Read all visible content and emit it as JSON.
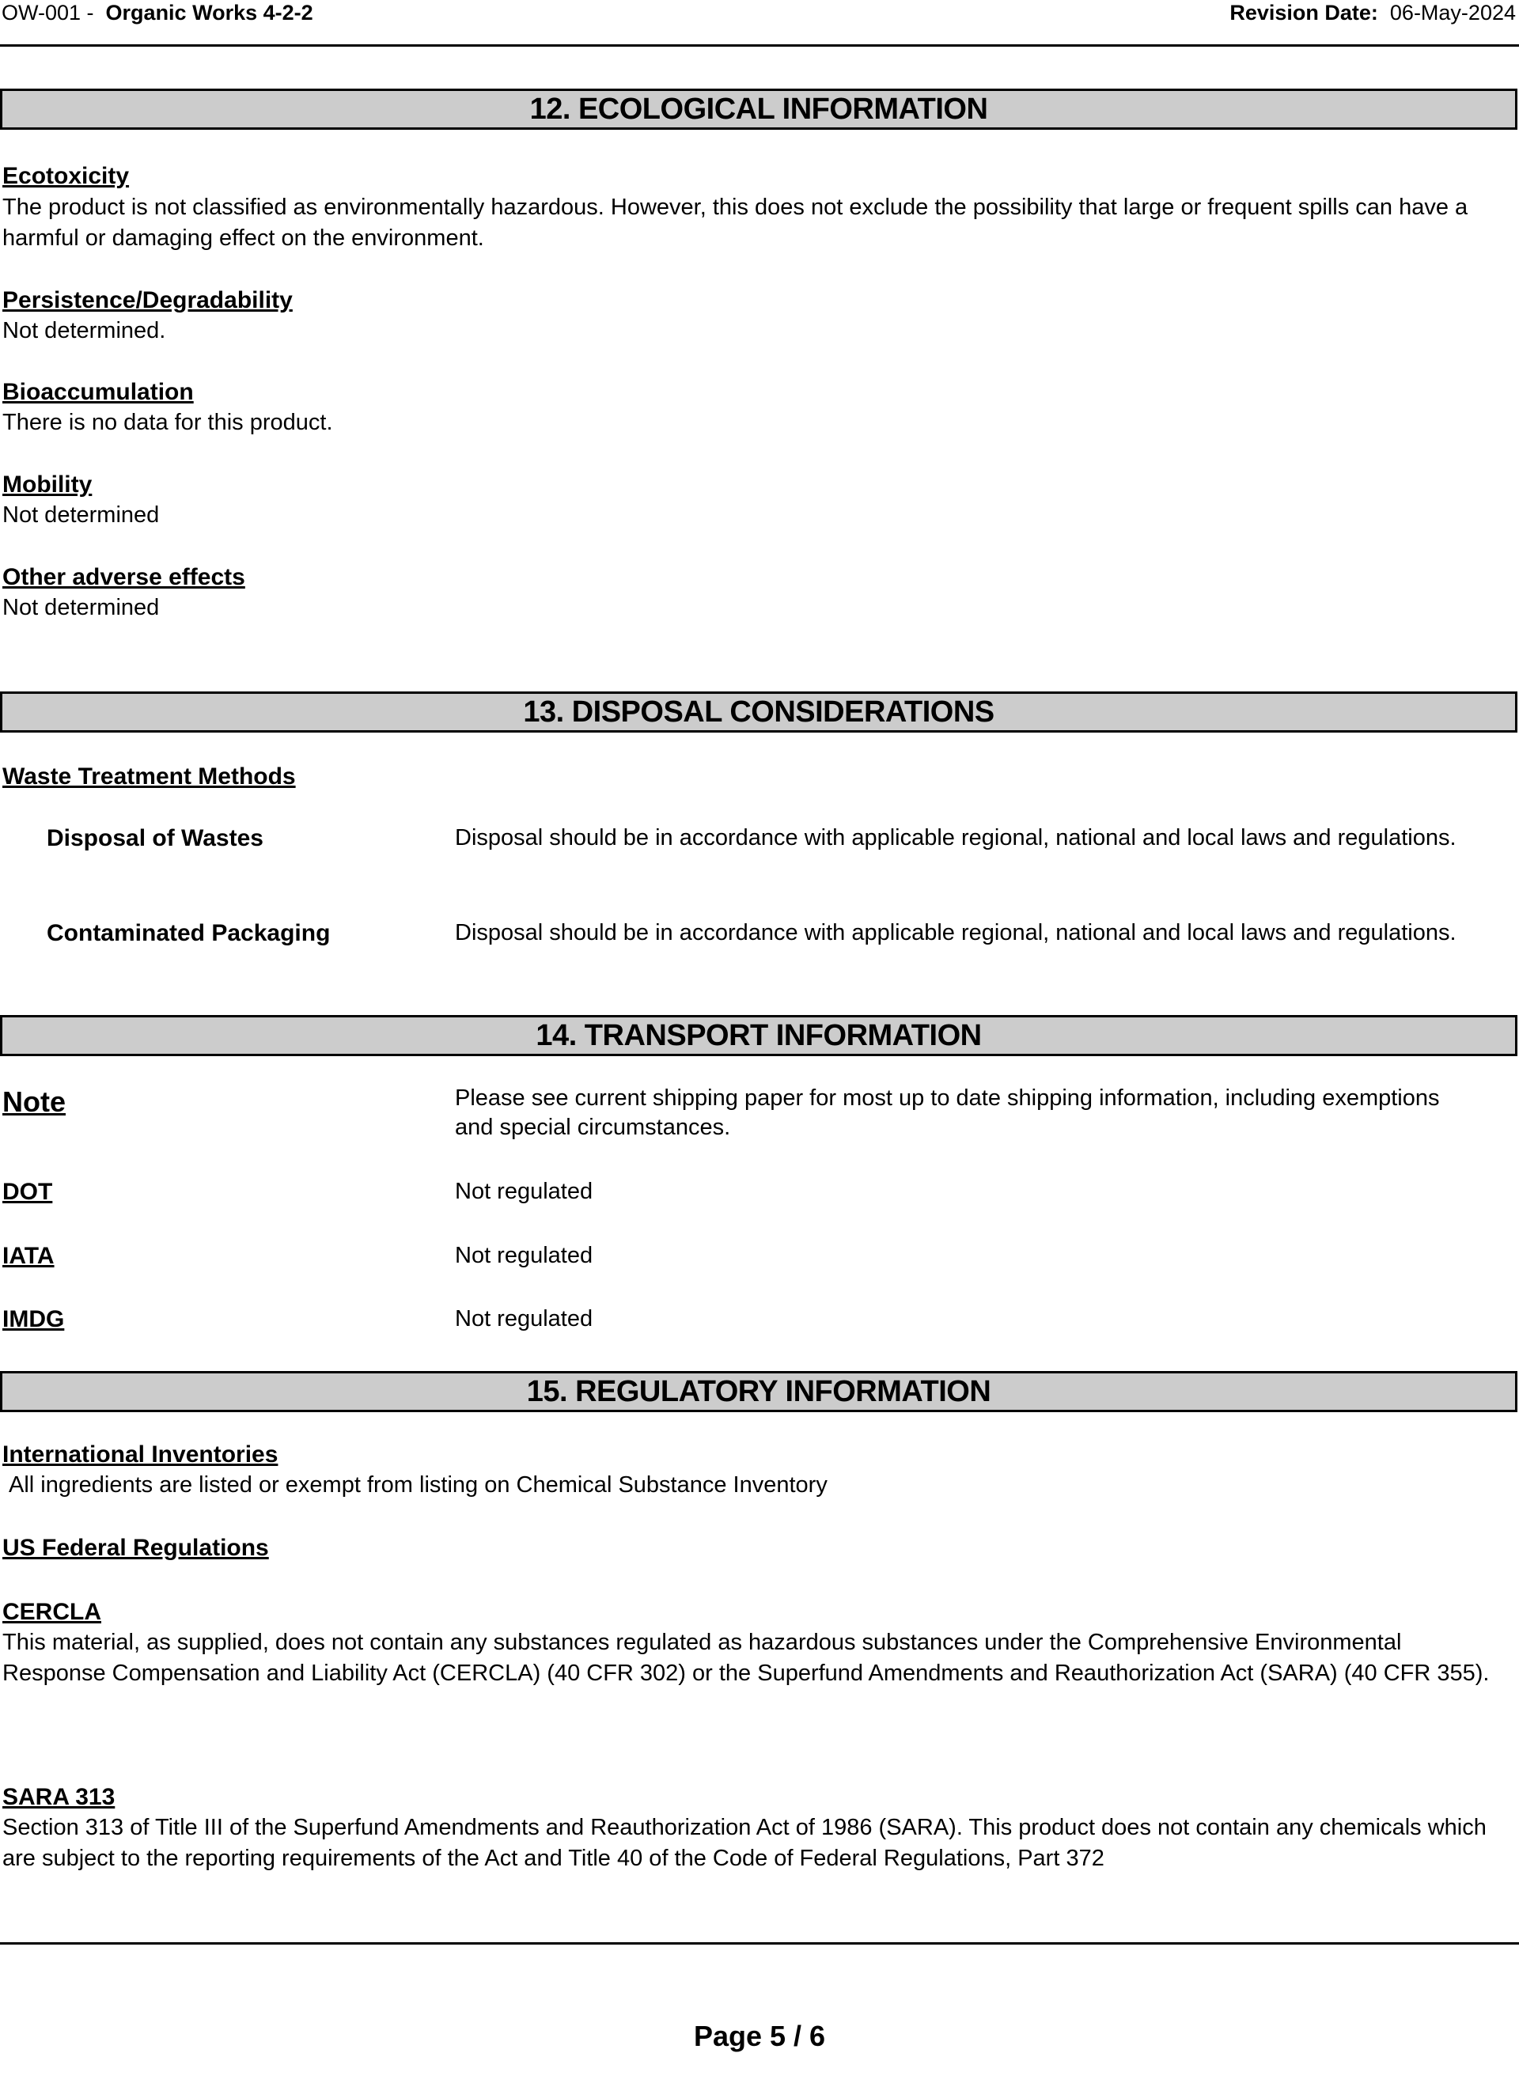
{
  "header": {
    "doc_code": "OW-001 -",
    "product_name": "Organic Works 4-2-2",
    "revision_label": "Revision Date:",
    "revision_date": "06-May-2024"
  },
  "sections": {
    "s12": {
      "title": "12. ECOLOGICAL INFORMATION",
      "ecotoxicity_heading": "Ecotoxicity",
      "ecotoxicity_text": "The product is not classified as environmentally hazardous. However, this does not exclude the possibility that large or frequent spills can have a harmful or damaging effect on the environment.",
      "persistence_heading": "Persistence/Degradability",
      "persistence_text": "Not determined.",
      "bioaccumulation_heading": "Bioaccumulation",
      "bioaccumulation_text": "There is no data for this product.",
      "mobility_heading": "Mobility",
      "mobility_text": "Not determined",
      "other_heading": "Other adverse effects",
      "other_text": "Not determined"
    },
    "s13": {
      "title": "13. DISPOSAL CONSIDERATIONS",
      "waste_heading": "Waste Treatment Methods",
      "rows": [
        {
          "label": "Disposal of Wastes",
          "value": "Disposal should be in accordance with applicable regional, national and local laws and regulations."
        },
        {
          "label": "Contaminated Packaging",
          "value": "Disposal should be in accordance with applicable regional, national and local laws and regulations."
        }
      ]
    },
    "s14": {
      "title": "14. TRANSPORT INFORMATION",
      "rows": [
        {
          "label": "Note",
          "value": "Please see current shipping paper for most up to date shipping information, including exemptions and special circumstances."
        },
        {
          "label": "DOT",
          "value": "Not regulated"
        },
        {
          "label": "IATA",
          "value": "Not regulated"
        },
        {
          "label": "IMDG",
          "value": "Not regulated"
        }
      ]
    },
    "s15": {
      "title": "15. REGULATORY INFORMATION",
      "intl_heading": "International Inventories",
      "intl_text": "All ingredients are listed or exempt from listing on Chemical Substance Inventory",
      "us_heading": "US Federal Regulations",
      "cercla_heading": "CERCLA",
      "cercla_text": "This material, as supplied, does not contain any substances regulated as hazardous substances under the Comprehensive Environmental Response Compensation and Liability Act (CERCLA) (40 CFR 302) or the Superfund Amendments and Reauthorization Act (SARA) (40 CFR 355).",
      "sara_heading": "SARA 313",
      "sara_text": "Section 313 of Title III of the Superfund Amendments and Reauthorization Act of 1986 (SARA). This product does not contain any chemicals which are subject to the reporting requirements of the Act and Title 40 of the Code of Federal Regulations, Part 372"
    }
  },
  "footer": {
    "page_label": "Page 5 / 6"
  }
}
